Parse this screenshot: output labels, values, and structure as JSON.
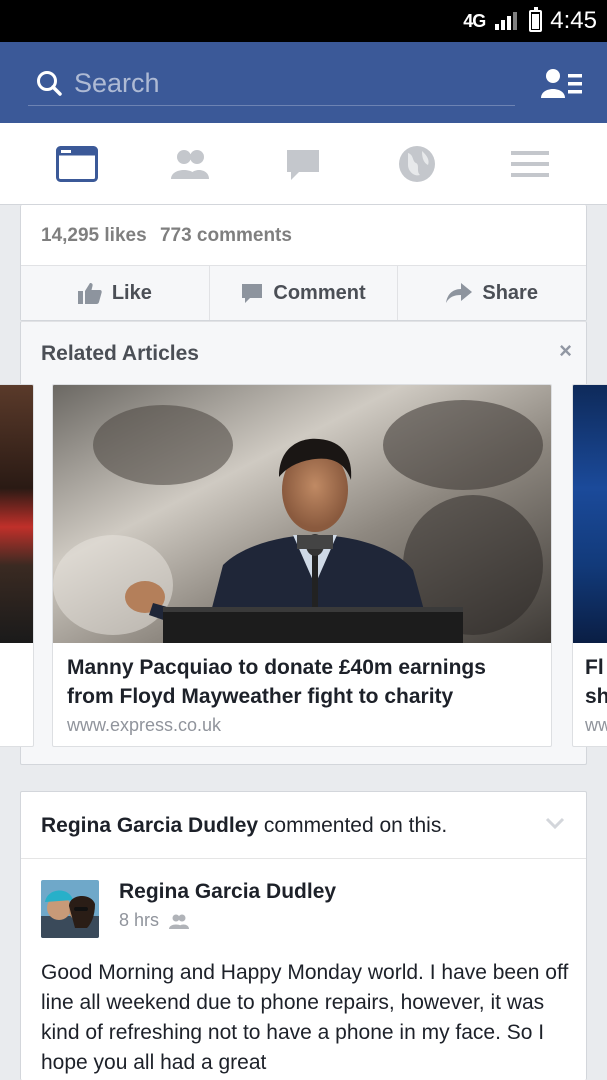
{
  "status_bar": {
    "network": "4G",
    "time": "4:45"
  },
  "search": {
    "placeholder": "Search"
  },
  "nav": {
    "items": [
      {
        "name": "news-feed",
        "icon": "news-feed-icon",
        "active": true
      },
      {
        "name": "friends",
        "icon": "friends-icon",
        "active": false
      },
      {
        "name": "messages",
        "icon": "messages-icon",
        "active": false
      },
      {
        "name": "notifications",
        "icon": "globe-icon",
        "active": false
      },
      {
        "name": "menu",
        "icon": "hamburger-icon",
        "active": false
      }
    ]
  },
  "post": {
    "likes": "14,295 likes",
    "comments": "773 comments",
    "actions": {
      "like": "Like",
      "comment": "Comment",
      "share": "Share"
    }
  },
  "related": {
    "title": "Related Articles",
    "close": "×",
    "main_article": {
      "title": "Manny Pacquiao to donate £40m earnings from Floyd Mayweather fight to charity",
      "source": "www.express.co.uk"
    },
    "next_article": {
      "title_start": "Fl",
      "title_line2": "sh",
      "source_start": "ww"
    }
  },
  "comment_story": {
    "actor": "Regina Garcia Dudley",
    "action": "commented on this.",
    "author": "Regina Garcia Dudley",
    "time": "8 hrs",
    "text": "Good Morning and Happy Monday world. I have been off line all weekend due to phone repairs, however, it was kind of refreshing not to have a phone in my face. So I hope you all had a great"
  },
  "colors": {
    "brand": "#3b5998",
    "active_nav": "#3b5998",
    "inactive_nav": "#c4c7cc"
  }
}
